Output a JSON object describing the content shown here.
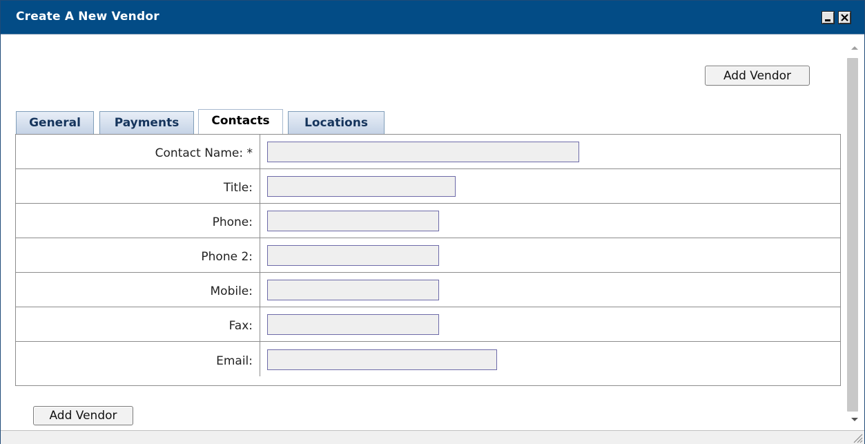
{
  "window": {
    "title": "Create A New Vendor",
    "colors": {
      "titlebar": "#034c86",
      "tab_border": "#7f9db9",
      "field_border": "#6d6aa8"
    }
  },
  "actions": {
    "add_vendor_top": "Add Vendor",
    "add_vendor_bottom": "Add Vendor"
  },
  "tabs": [
    {
      "label": "General",
      "active": false
    },
    {
      "label": "Payments",
      "active": false
    },
    {
      "label": "Contacts",
      "active": true
    },
    {
      "label": "Locations",
      "active": false
    }
  ],
  "form": {
    "fields": [
      {
        "label": "Contact Name: *",
        "value": ""
      },
      {
        "label": "Title:",
        "value": ""
      },
      {
        "label": "Phone:",
        "value": ""
      },
      {
        "label": "Phone 2:",
        "value": ""
      },
      {
        "label": "Mobile:",
        "value": ""
      },
      {
        "label": "Fax:",
        "value": ""
      },
      {
        "label": "Email:",
        "value": ""
      }
    ]
  },
  "icons": [
    "minimize-icon",
    "close-icon",
    "scroll-up-icon",
    "scroll-down-icon",
    "resize-grip-icon"
  ]
}
